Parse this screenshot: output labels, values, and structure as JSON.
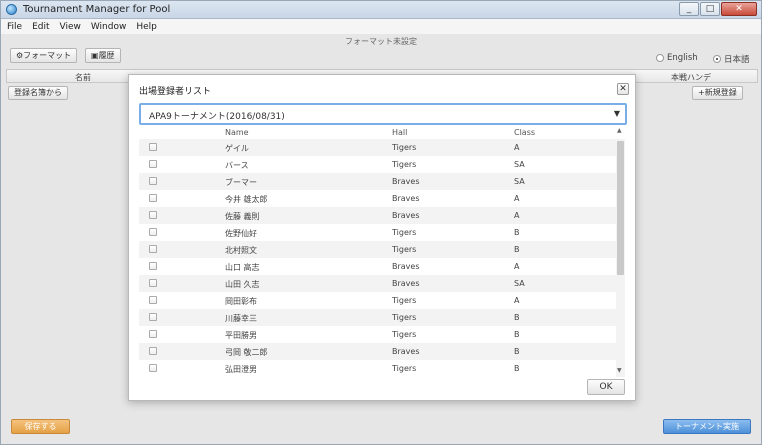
{
  "window": {
    "title": "Tournament Manager for Pool",
    "controls": [
      "_",
      "□",
      "✕"
    ]
  },
  "menu": [
    "File",
    "Edit",
    "View",
    "Window",
    "Help"
  ],
  "app": {
    "format_status": "フォーマット未設定",
    "format_button": "フォーマット",
    "history_button": "履歴",
    "lang_english": "English",
    "lang_japanese": "日本語",
    "columns": [
      "名前",
      "本戦ハンデ"
    ],
    "from_roster_button": "登録名簿から",
    "new_registration_button": "+新規登録",
    "save_button": "保存する",
    "run_tournament_button": "トーナメント実施"
  },
  "modal": {
    "title": "出場登録者リスト",
    "select_value": "APA9トーナメント(2016/08/31)",
    "columns": {
      "name": "Name",
      "hall": "Hall",
      "class": "Class"
    },
    "rows": [
      {
        "name": "ゲイル",
        "hall": "Tigers",
        "class": "A"
      },
      {
        "name": "バース",
        "hall": "Tigers",
        "class": "SA"
      },
      {
        "name": "ブーマー",
        "hall": "Braves",
        "class": "SA"
      },
      {
        "name": "今井 雄太郎",
        "hall": "Braves",
        "class": "A"
      },
      {
        "name": "佐藤 義則",
        "hall": "Braves",
        "class": "A"
      },
      {
        "name": "佐野仙好",
        "hall": "Tigers",
        "class": "B"
      },
      {
        "name": "北村照文",
        "hall": "Tigers",
        "class": "B"
      },
      {
        "name": "山口 高志",
        "hall": "Braves",
        "class": "A"
      },
      {
        "name": "山田 久志",
        "hall": "Braves",
        "class": "SA"
      },
      {
        "name": "岡田彰布",
        "hall": "Tigers",
        "class": "A"
      },
      {
        "name": "川藤幸三",
        "hall": "Tigers",
        "class": "B"
      },
      {
        "name": "平田勝男",
        "hall": "Tigers",
        "class": "B"
      },
      {
        "name": "弓岡 敬二郎",
        "hall": "Braves",
        "class": "B"
      },
      {
        "name": "弘田澄男",
        "hall": "Tigers",
        "class": "B"
      }
    ],
    "ok_button": "OK"
  }
}
